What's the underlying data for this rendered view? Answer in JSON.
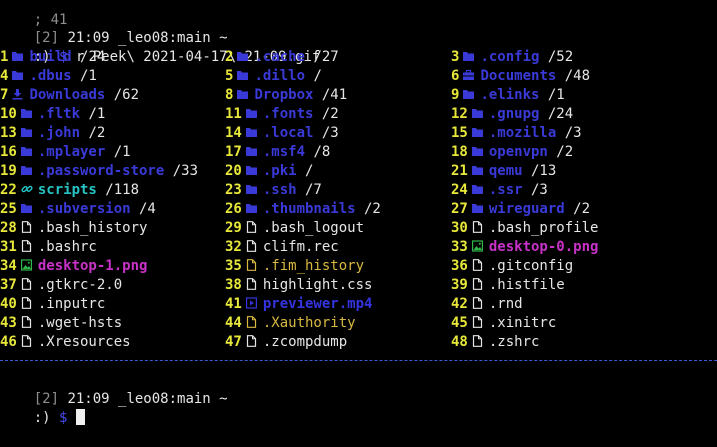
{
  "colors": {
    "dir": "#3a3ad8",
    "symlink": "#26c4c4",
    "image": "#c832c8",
    "video": "#3434e0",
    "hidden_file": "#d8b840",
    "file": "#e6e6e6",
    "number": "#e8e83a",
    "separator": "#3a5bd8"
  },
  "top": {
    "partial_line": "; 41",
    "prompt1_tag": "[2]",
    "prompt1_rest": " 21:09 _leo08:main ~",
    "prompt2_mark": ":)",
    "prompt2_dollar": "$",
    "command": " r Peek\\ 2021-04-17\\ 21-09.gif"
  },
  "entries": [
    {
      "n": "1",
      "name": "build",
      "size": "/24",
      "type": "dir",
      "icon": "folder-icon"
    },
    {
      "n": "2",
      "name": ".cache",
      "size": "/27",
      "type": "dir",
      "icon": "folder-icon"
    },
    {
      "n": "3",
      "name": ".config",
      "size": "/52",
      "type": "dir",
      "icon": "folder-icon"
    },
    {
      "n": "4",
      "name": ".dbus",
      "size": "/1",
      "type": "dir",
      "icon": "folder-icon"
    },
    {
      "n": "5",
      "name": ".dillo",
      "size": "/",
      "type": "dir",
      "icon": "folder-icon"
    },
    {
      "n": "6",
      "name": "Documents",
      "size": "/48",
      "type": "dir",
      "icon": "briefcase-icon"
    },
    {
      "n": "7",
      "name": "Downloads",
      "size": "/62",
      "type": "dir",
      "icon": "download-icon"
    },
    {
      "n": "8",
      "name": "Dropbox",
      "size": "/41",
      "type": "dir",
      "icon": "folder-icon"
    },
    {
      "n": "9",
      "name": ".elinks",
      "size": "/1",
      "type": "dir",
      "icon": "folder-icon"
    },
    {
      "n": "10",
      "name": ".fltk",
      "size": "/1",
      "type": "dir",
      "icon": "folder-icon"
    },
    {
      "n": "11",
      "name": ".fonts",
      "size": "/2",
      "type": "dir",
      "icon": "folder-icon"
    },
    {
      "n": "12",
      "name": ".gnupg",
      "size": "/24",
      "type": "dir",
      "icon": "folder-icon"
    },
    {
      "n": "13",
      "name": ".john",
      "size": "/2",
      "type": "dir",
      "icon": "folder-icon"
    },
    {
      "n": "14",
      "name": ".local",
      "size": "/3",
      "type": "dir",
      "icon": "folder-icon"
    },
    {
      "n": "15",
      "name": ".mozilla",
      "size": "/3",
      "type": "dir",
      "icon": "folder-icon"
    },
    {
      "n": "16",
      "name": ".mplayer",
      "size": "/1",
      "type": "dir",
      "icon": "folder-icon"
    },
    {
      "n": "17",
      "name": ".msf4",
      "size": "/8",
      "type": "dir",
      "icon": "folder-icon"
    },
    {
      "n": "18",
      "name": "openvpn",
      "size": "/2",
      "type": "dir",
      "icon": "folder-icon"
    },
    {
      "n": "19",
      "name": ".password-store",
      "size": "/33",
      "type": "dir",
      "icon": "folder-icon"
    },
    {
      "n": "20",
      "name": ".pki",
      "size": "/",
      "type": "dir",
      "icon": "folder-icon"
    },
    {
      "n": "21",
      "name": "qemu",
      "size": "/13",
      "type": "dir",
      "icon": "folder-icon"
    },
    {
      "n": "22",
      "name": "scripts",
      "size": "/118",
      "type": "symlink",
      "icon": "link-icon"
    },
    {
      "n": "23",
      "name": ".ssh",
      "size": "/7",
      "type": "dir",
      "icon": "folder-icon"
    },
    {
      "n": "24",
      "name": ".ssr",
      "size": "/3",
      "type": "dir",
      "icon": "folder-icon"
    },
    {
      "n": "25",
      "name": ".subversion",
      "size": "/4",
      "type": "dir",
      "icon": "folder-icon"
    },
    {
      "n": "26",
      "name": ".thumbnails",
      "size": "/2",
      "type": "dir",
      "icon": "folder-icon"
    },
    {
      "n": "27",
      "name": "wireguard",
      "size": "/2",
      "type": "dir",
      "icon": "folder-icon"
    },
    {
      "n": "28",
      "name": ".bash_history",
      "size": "",
      "type": "file",
      "icon": "file-icon"
    },
    {
      "n": "29",
      "name": ".bash_logout",
      "size": "",
      "type": "file",
      "icon": "file-icon"
    },
    {
      "n": "30",
      "name": ".bash_profile",
      "size": "",
      "type": "file",
      "icon": "file-icon"
    },
    {
      "n": "31",
      "name": ".bashrc",
      "size": "",
      "type": "file",
      "icon": "file-icon"
    },
    {
      "n": "32",
      "name": "clifm.rec",
      "size": "",
      "type": "file",
      "icon": "file-icon"
    },
    {
      "n": "33",
      "name": "desktop-0.png",
      "size": "",
      "type": "image",
      "icon": "image-icon"
    },
    {
      "n": "34",
      "name": "desktop-1.png",
      "size": "",
      "type": "image",
      "icon": "image-icon"
    },
    {
      "n": "35",
      "name": ".fim_history",
      "size": "",
      "type": "hidden_file",
      "icon": "file-icon"
    },
    {
      "n": "36",
      "name": ".gitconfig",
      "size": "",
      "type": "file",
      "icon": "file-icon"
    },
    {
      "n": "37",
      "name": ".gtkrc-2.0",
      "size": "",
      "type": "file",
      "icon": "file-icon"
    },
    {
      "n": "38",
      "name": "highlight.css",
      "size": "",
      "type": "file",
      "icon": "file-icon"
    },
    {
      "n": "39",
      "name": ".histfile",
      "size": "",
      "type": "file",
      "icon": "file-icon"
    },
    {
      "n": "40",
      "name": ".inputrc",
      "size": "",
      "type": "file",
      "icon": "file-icon"
    },
    {
      "n": "41",
      "name": "previewer.mp4",
      "size": "",
      "type": "video",
      "icon": "video-icon"
    },
    {
      "n": "42",
      "name": ".rnd",
      "size": "",
      "type": "file",
      "icon": "file-icon"
    },
    {
      "n": "43",
      "name": ".wget-hsts",
      "size": "",
      "type": "file",
      "icon": "file-icon"
    },
    {
      "n": "44",
      "name": ".Xauthority",
      "size": "",
      "type": "hidden_file",
      "icon": "file-icon"
    },
    {
      "n": "45",
      "name": ".xinitrc",
      "size": "",
      "type": "file",
      "icon": "file-icon"
    },
    {
      "n": "46",
      "name": ".Xresources",
      "size": "",
      "type": "file",
      "icon": "file-icon"
    },
    {
      "n": "47",
      "name": ".zcompdump",
      "size": "",
      "type": "file",
      "icon": "file-icon"
    },
    {
      "n": "48",
      "name": ".zshrc",
      "size": "",
      "type": "file",
      "icon": "file-icon"
    }
  ],
  "bottom": {
    "prompt1_tag": "[2]",
    "prompt1_rest": " 21:09 _leo08:main ~",
    "prompt2_mark": ":)",
    "prompt2_dollar": "$"
  }
}
